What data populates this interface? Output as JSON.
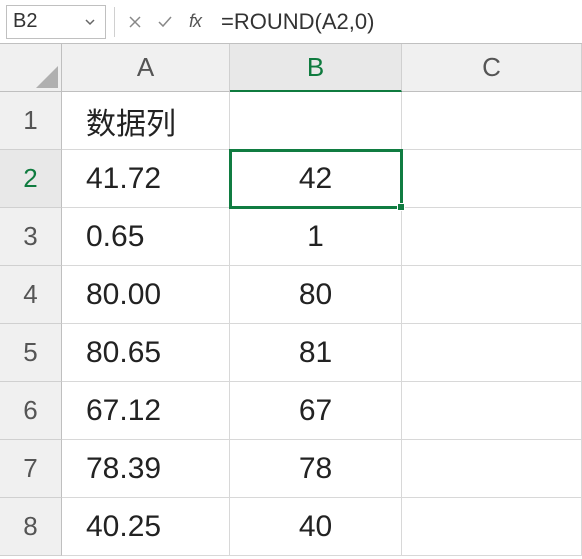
{
  "formula_bar": {
    "name_box": "B2",
    "formula": "=ROUND(A2,0)",
    "fx_label": "fx"
  },
  "columns": [
    "A",
    "B",
    "C"
  ],
  "rows": [
    "1",
    "2",
    "3",
    "4",
    "5",
    "6",
    "7",
    "8"
  ],
  "active_cell": {
    "row": 2,
    "col": "B"
  },
  "cells": {
    "A1": "数据列",
    "A2": "41.72",
    "A3": "0.65",
    "A4": "80.00",
    "A5": "80.65",
    "A6": "67.12",
    "A7": "78.39",
    "A8": "40.25",
    "B1": "",
    "B2": "42",
    "B3": "1",
    "B4": "80",
    "B5": "81",
    "B6": "67",
    "B7": "78",
    "B8": "40"
  },
  "chart_data": {
    "type": "table",
    "title": "数据列",
    "series": [
      {
        "name": "A",
        "values": [
          41.72,
          0.65,
          80.0,
          80.65,
          67.12,
          78.39,
          40.25
        ]
      },
      {
        "name": "B (ROUND(A,0))",
        "values": [
          42,
          1,
          80,
          81,
          67,
          78,
          40
        ]
      }
    ]
  }
}
